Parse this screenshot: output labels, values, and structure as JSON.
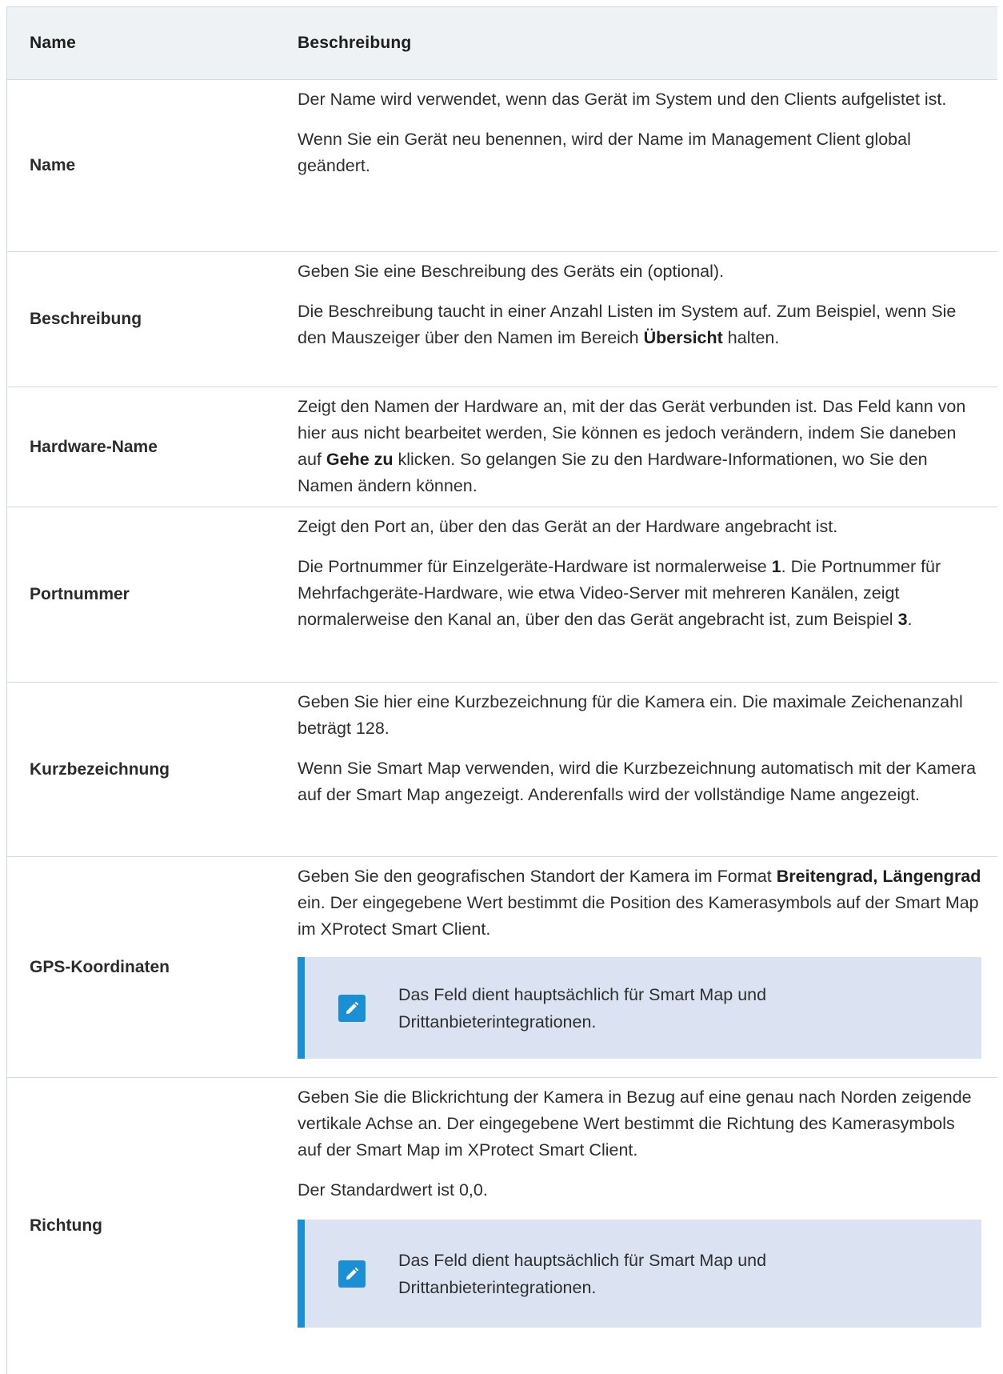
{
  "table": {
    "header": {
      "col1": "Name",
      "col2": "Beschreibung"
    },
    "rows": [
      {
        "name": "Name",
        "p": [
          "Der Name wird verwendet, wenn das Gerät im System und den Clients aufgelistet ist.",
          "Wenn Sie ein Gerät neu benennen, wird der Name im Management Client global geändert."
        ]
      },
      {
        "name": "Beschreibung",
        "p": [
          "Geben Sie eine Beschreibung des Geräts ein (optional).",
          "Die Beschreibung taucht in einer Anzahl Listen im System auf. Zum Beispiel, wenn Sie den Mauszeiger über den Namen im Bereich",
          "Übersicht",
          "halten."
        ]
      },
      {
        "name": "Hardware-Name",
        "p": [
          "Zeigt den Namen der Hardware an, mit der das Gerät verbunden ist. Das Feld kann von hier aus nicht bearbeitet werden, Sie können es jedoch verändern, indem Sie daneben auf",
          "Gehe zu",
          "klicken. So gelangen Sie zu den Hardware-Informationen, wo Sie den Namen ändern können."
        ]
      },
      {
        "name": "Portnummer",
        "p": [
          "Zeigt den Port an, über den das Gerät an der Hardware angebracht ist.",
          "Die Portnummer für Einzelgeräte-Hardware ist normalerweise",
          "1",
          ". Die Portnummer für Mehrfachgeräte-Hardware, wie etwa Video-Server mit mehreren Kanälen, zeigt normalerweise den Kanal an, über den das Gerät angebracht ist, zum Beispiel",
          "3",
          "."
        ]
      },
      {
        "name": "Kurzbezeichnung",
        "p": [
          "Geben Sie hier eine Kurzbezeichnung für die Kamera ein. Die maximale Zeichenanzahl beträgt 128.",
          "Wenn Sie Smart Map verwenden, wird die Kurzbezeichnung automatisch mit der Kamera auf der Smart Map angezeigt. Anderenfalls wird der vollständige Name angezeigt."
        ]
      },
      {
        "name": "GPS-Koordinaten",
        "p": [
          "Geben Sie den geografischen Standort der Kamera im Format",
          "Breitengrad, Längengrad",
          "ein. Der eingegebene Wert bestimmt die Position des Kamerasymbols auf der Smart Map im XProtect Smart Client."
        ],
        "note": "Das Feld dient hauptsächlich für Smart Map und Drittanbieterintegrationen."
      },
      {
        "name": "Richtung",
        "p": [
          "Geben Sie die Blickrichtung der Kamera in Bezug auf eine genau nach Norden zeigende vertikale Achse an. Der eingegebene Wert bestimmt die Richtung des Kamerasymbols auf der Smart Map im XProtect Smart Client.",
          "Der Standardwert ist 0,0."
        ],
        "note": "Das Feld dient hauptsächlich für Smart Map und Drittanbieterintegrationen."
      }
    ]
  },
  "colors": {
    "header_bg": "#eff2f5",
    "note_bg": "#dbe3f2",
    "note_accent": "#1a8fd4",
    "border": "#d3d8dc"
  },
  "icons": {
    "note_icon": "pencil-icon"
  }
}
